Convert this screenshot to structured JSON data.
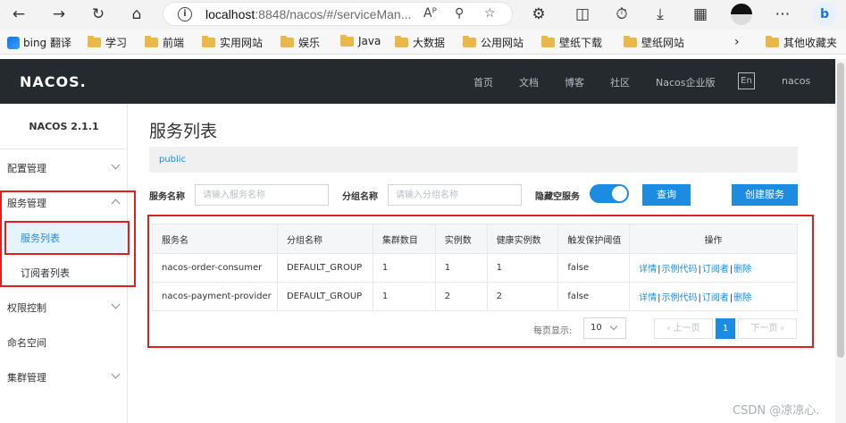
{
  "browser": {
    "url_host": "localhost",
    "url_rest": ":8848/nacos/#/serviceMan...",
    "read_aloud": "Aᴾ"
  },
  "bookmarks": [
    {
      "label": "bing 翻译",
      "type": "bing"
    },
    {
      "label": "学习",
      "type": "folder"
    },
    {
      "label": "前端",
      "type": "folder"
    },
    {
      "label": "实用网站",
      "type": "folder"
    },
    {
      "label": "娱乐",
      "type": "folder"
    },
    {
      "label": "Java",
      "type": "folder"
    },
    {
      "label": "大数据",
      "type": "folder"
    },
    {
      "label": "公用网站",
      "type": "folder"
    },
    {
      "label": "壁纸下载",
      "type": "folder"
    },
    {
      "label": "壁纸网站",
      "type": "folder"
    },
    {
      "label": "其他收藏夹",
      "type": "folder"
    }
  ],
  "header": {
    "logo": "NACOS.",
    "nav": [
      "首页",
      "文档",
      "博客",
      "社区",
      "Nacos企业版"
    ],
    "lang": "En",
    "user": "nacos"
  },
  "sidebar": {
    "version": "NACOS 2.1.1",
    "menu": {
      "config": "配置管理",
      "service": "服务管理",
      "service_list": "服务列表",
      "subscriber_list": "订阅者列表",
      "auth": "权限控制",
      "namespace": "命名空间",
      "cluster": "集群管理"
    }
  },
  "main": {
    "title": "服务列表",
    "namespace": "public",
    "filters": {
      "service_name_label": "服务名称",
      "service_name_placeholder": "请输入服务名称",
      "group_name_label": "分组名称",
      "group_name_placeholder": "请输入分组名称",
      "hide_empty_label": "隐藏空服务",
      "hide_empty_on": true,
      "query_button": "查询",
      "create_button": "创建服务"
    },
    "table": {
      "headers": [
        "服务名",
        "分组名称",
        "集群数目",
        "实例数",
        "健康实例数",
        "触发保护阈值",
        "操作"
      ],
      "rows": [
        {
          "service": "nacos-order-consumer",
          "group": "DEFAULT_GROUP",
          "clusters": "1",
          "instances": "1",
          "healthy": "1",
          "threshold": "false"
        },
        {
          "service": "nacos-payment-provider",
          "group": "DEFAULT_GROUP",
          "clusters": "1",
          "instances": "2",
          "healthy": "2",
          "threshold": "false"
        }
      ],
      "ops": {
        "detail": "详情",
        "sample": "示例代码",
        "subscriber": "订阅者",
        "delete": "删除",
        "sep": "|"
      }
    },
    "pager": {
      "per_page_label": "每页显示:",
      "per_page": "10",
      "prev": "上一页",
      "current": "1",
      "next": "下一页"
    }
  },
  "watermark": "CSDN @凉凉心.",
  "colors": {
    "accent": "#1c8ce3",
    "header_bg": "#252a2f",
    "highlight_box": "#e02020"
  }
}
